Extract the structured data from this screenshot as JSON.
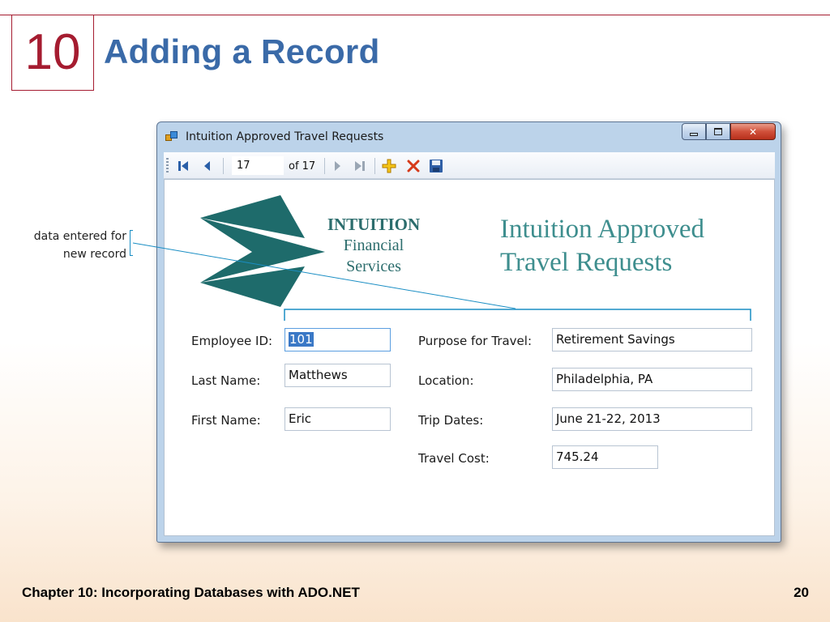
{
  "slide": {
    "chapter_number": "10",
    "title": "Adding a Record",
    "footer": "Chapter 10: Incorporating Databases with ADO.NET",
    "page_number": "20",
    "accent_color": "#a51c30",
    "title_color": "#3a6aa8"
  },
  "callout": {
    "line1": "data entered for",
    "line2": "new record",
    "color": "#1a8ec4"
  },
  "window": {
    "title": "Intuition Approved Travel Requests",
    "icon": "form-app-icon",
    "controls": [
      "minimize-icon",
      "maximize-icon",
      "close-icon"
    ]
  },
  "navigator": {
    "position": "17",
    "count_label": "of 17",
    "buttons": [
      "move-first-icon",
      "move-previous-icon",
      "move-next-icon",
      "move-last-icon",
      "add-new-icon",
      "delete-icon",
      "save-icon"
    ]
  },
  "logo": {
    "line1": "INTUITION",
    "line2": "Financial",
    "line3": "Services"
  },
  "heading": {
    "line1": "Intuition Approved",
    "line2": "Travel Requests"
  },
  "form": {
    "employee_id": {
      "label": "Employee ID:",
      "value": "101"
    },
    "last_name": {
      "label": "Last Name:",
      "value": "Matthews"
    },
    "first_name": {
      "label": "First Name:",
      "value": "Eric"
    },
    "purpose": {
      "label": "Purpose for Travel:",
      "value": "Retirement Savings"
    },
    "location": {
      "label": "Location:",
      "value": "Philadelphia, PA"
    },
    "trip_dates": {
      "label": "Trip Dates:",
      "value": "June 21-22, 2013"
    },
    "travel_cost": {
      "label": "Travel Cost:",
      "value": "745.24"
    }
  }
}
